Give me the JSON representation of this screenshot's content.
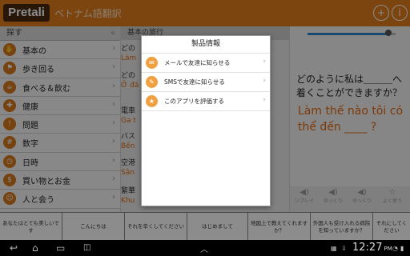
{
  "header": {
    "logo": "Pretali",
    "title": "ベトナム語翻訳"
  },
  "sidebar": {
    "search_label": "探す",
    "items": [
      {
        "label": "基本の",
        "icon": "palm-icon"
      },
      {
        "label": "歩き回る",
        "icon": "walk-icon"
      },
      {
        "label": "食べる＆飲む",
        "icon": "cup-icon"
      },
      {
        "label": "健康",
        "icon": "health-icon"
      },
      {
        "label": "問題",
        "icon": "warning-icon"
      },
      {
        "label": "数字",
        "icon": "numbers-icon"
      },
      {
        "label": "日時",
        "icon": "clock-icon"
      },
      {
        "label": "買い物とお金",
        "icon": "shopping-icon"
      },
      {
        "label": "人と会う",
        "icon": "people-icon"
      }
    ]
  },
  "middle": {
    "header": "基本の旅行",
    "phrases": [
      {
        "jp": "どの",
        "vi": "Làm"
      },
      {
        "jp": "どの",
        "vi": "Ở đâ"
      },
      {
        "jp": "電車",
        "vi": "Ga t"
      },
      {
        "jp": "バス",
        "vi": "Bến"
      },
      {
        "jp": "空港",
        "vi": "Sân"
      },
      {
        "jp": "繁華",
        "vi": "Khu"
      }
    ]
  },
  "detail": {
    "jp_text": "どのように私は＿＿＿へ着くことができますか？",
    "vn_text": "Làm thế nào tôi có thể đến ____ ?",
    "actions": [
      {
        "label": "リプレイ",
        "icon": "speaker-icon"
      },
      {
        "label": "ゆっくり",
        "icon": "slow-speaker-icon"
      },
      {
        "label": "ゆっくり",
        "icon": "speaker-icon"
      },
      {
        "label": "よく使う",
        "icon": "star-icon"
      }
    ],
    "volume": 0.92
  },
  "dialog": {
    "title": "製品情報",
    "items": [
      {
        "label": "メールで友達に知らせる",
        "icon": "mail-icon"
      },
      {
        "label": "SMSで友達に知らせる",
        "icon": "sms-icon"
      },
      {
        "label": "このアプリを評価する",
        "icon": "star-icon"
      }
    ]
  },
  "quick_phrases": [
    "あなたはとても美しいです",
    "こんにちは",
    "それを辛くしてください",
    "はじめまして",
    "地図上で教えてくれますか？",
    "外国人も受け入れる病院を知っていますか？",
    "それにしてください"
  ],
  "system_bar": {
    "time": "12:27",
    "ampm": "PM"
  },
  "colors": {
    "brand_orange": "#e27d1c",
    "vn_text": "#e26a12"
  }
}
